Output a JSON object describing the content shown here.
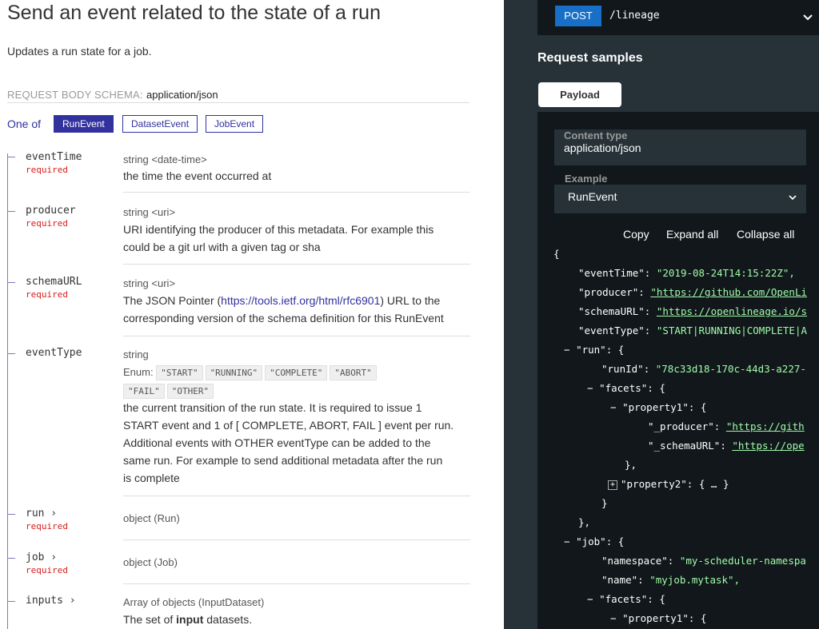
{
  "left": {
    "title": "Send an event related to the state of a run",
    "description": "Updates a run state for a job.",
    "schema_label": "REQUEST BODY SCHEMA:",
    "schema_value": "application/json",
    "oneof_label": "One of",
    "oneof_options": [
      "RunEvent",
      "DatasetEvent",
      "JobEvent"
    ],
    "required_label": "required",
    "props": {
      "eventTime": {
        "name": "eventTime",
        "type": "string <date-time>",
        "text": "the time the event occurred at"
      },
      "producer": {
        "name": "producer",
        "type": "string <uri>",
        "line1": "URI identifying the producer of this metadata. For example this",
        "line2": "could be a git url with a given tag or sha"
      },
      "schemaURL": {
        "name": "schemaURL",
        "type": "string <uri>",
        "line1_pre": "The JSON Pointer (",
        "link": "https://tools.ietf.org/html/rfc6901",
        "line1_post": ") URL to the",
        "line2": "corresponding version of the schema definition for this RunEvent"
      },
      "eventType": {
        "name": "eventType",
        "type": "string",
        "enum_label": "Enum:",
        "enum": [
          "\"START\"",
          "\"RUNNING\"",
          "\"COMPLETE\"",
          "\"ABORT\"",
          "\"FAIL\"",
          "\"OTHER\""
        ],
        "lines": [
          "the current transition of the run state. It is required to issue 1",
          "START event and 1 of [ COMPLETE, ABORT, FAIL ] event per run.",
          "Additional events with OTHER eventType can be added to the",
          "same run. For example to send additional metadata after the run",
          "is complete"
        ]
      },
      "run": {
        "name": "run ›",
        "type": "object (Run)"
      },
      "job": {
        "name": "job ›",
        "type": "object (Job)"
      },
      "inputs": {
        "name": "inputs ›",
        "type": "Array of objects (InputDataset)",
        "text_pre": "The set of ",
        "text_bold": "input",
        "text_post": " datasets."
      }
    }
  },
  "right": {
    "method": "POST",
    "path": "/lineage",
    "samples_title": "Request samples",
    "tab": "Payload",
    "content_type_label": "Content type",
    "content_type_value": "application/json",
    "example_label": "Example",
    "example_value": "RunEvent",
    "tools": [
      "Copy",
      "Expand all",
      "Collapse all"
    ],
    "json": {
      "open": "{",
      "eventTime_k": "\"eventTime\"",
      "eventTime_v": "\"2019-08-24T14:15:22Z\",",
      "producer_k": "\"producer\"",
      "producer_v": "\"https://github.com/OpenLi",
      "schemaURL_k": "\"schemaURL\"",
      "schemaURL_v": "\"https://openlineage.io/s",
      "eventType_k": "\"eventType\"",
      "eventType_v": "\"START|RUNNING|COMPLETE|A",
      "run_k": "\"run\"",
      "runId_k": "\"runId\"",
      "runId_v": "\"78c33d18-170c-44d3-a227-",
      "facets_k": "\"facets\"",
      "property1_k": "\"property1\"",
      "producer2_k": "\"_producer\"",
      "producer2_v": "\"https://gith",
      "schemaURL2_k": "\"_schemaURL\"",
      "schemaURL2_v": "\"https://ope",
      "property2_k": "\"property2\"",
      "property2_v": "{ … }",
      "job_k": "\"job\"",
      "namespace_k": "\"namespace\"",
      "namespace_v": "\"my-scheduler-namespa",
      "name_k": "\"name\"",
      "name_v": "\"myjob.mytask\",",
      "facets2_k": "\"facets\"",
      "property1b_k": "\"property1\"",
      "brace_open": "{",
      "brace_close": "}",
      "brace_close_comma": "},",
      "minus": "−",
      "plus": "+",
      "colon": ": "
    }
  }
}
